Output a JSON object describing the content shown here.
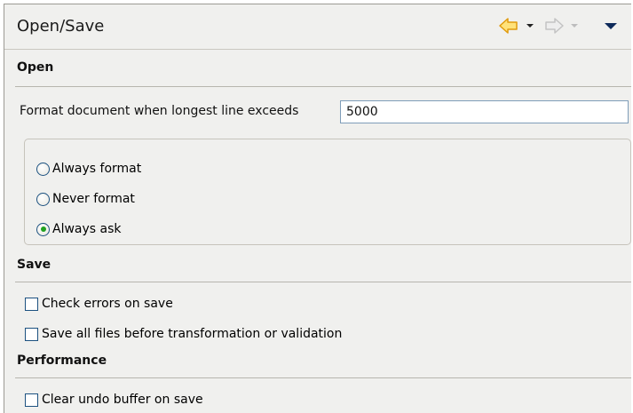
{
  "header": {
    "title": "Open/Save",
    "icons": [
      "back-arrow-icon",
      "dropdown-icon",
      "forward-arrow-icon",
      "dropdown-icon",
      "view-menu-icon"
    ]
  },
  "open": {
    "title": "Open",
    "format_label": "Format document when longest line exceeds",
    "format_value": "5000",
    "options": [
      {
        "label": "Always format",
        "selected": false
      },
      {
        "label": "Never format",
        "selected": false
      },
      {
        "label": "Always ask",
        "selected": true
      }
    ]
  },
  "save": {
    "title": "Save",
    "checks": [
      {
        "label": "Check errors on save",
        "checked": false
      },
      {
        "label": "Save all files before transformation or validation",
        "checked": false
      }
    ]
  },
  "performance": {
    "title": "Performance",
    "checks": [
      {
        "label": "Clear undo buffer on save",
        "checked": false
      }
    ]
  },
  "colors": {
    "back_arrow": "#f2b01e",
    "forward_arrow": "#cfcfcf",
    "radio_selected": "#21a121"
  }
}
